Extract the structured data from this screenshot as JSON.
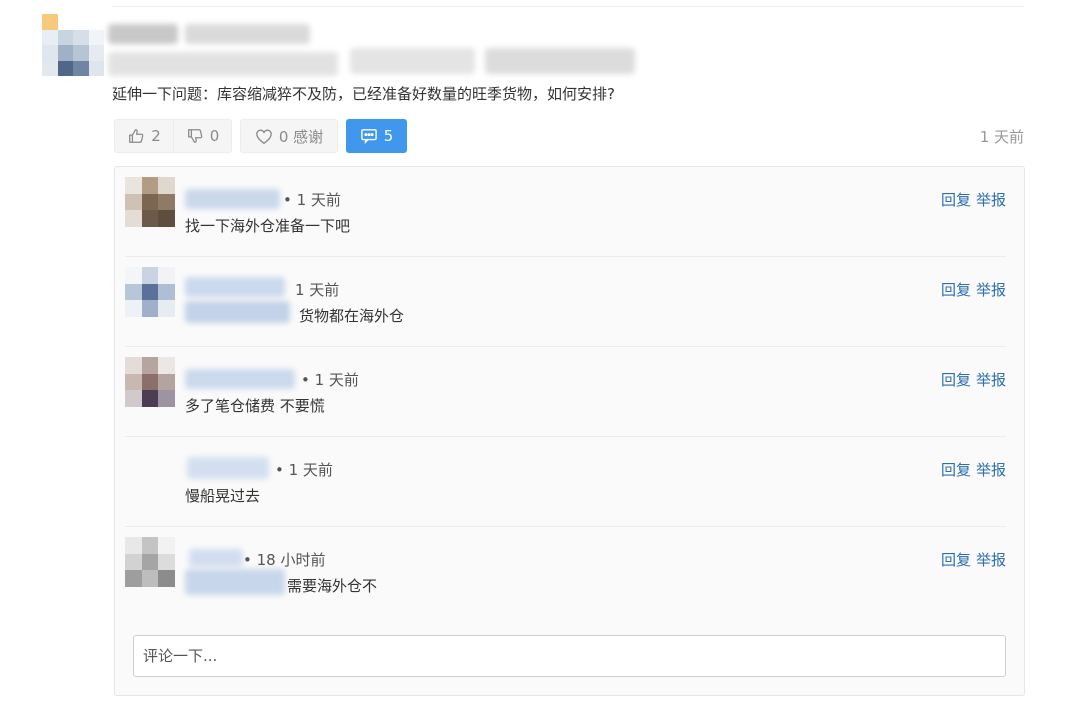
{
  "question": {
    "text": "延伸一下问题：库容缩减猝不及防，已经准备好数量的旺季货物，如何安排?",
    "time": "1 天前",
    "like_count": "2",
    "dislike_count": "0",
    "thanks_label": "0 感谢",
    "comment_count": "5"
  },
  "comments": [
    {
      "meta": "• 1 天前",
      "text": "找一下海外仓准备一下吧"
    },
    {
      "meta": "1 天前",
      "text": "货物都在海外仓"
    },
    {
      "meta": "• 1 天前",
      "text": "多了笔仓储费 不要慌"
    },
    {
      "meta": "• 1 天前",
      "text": "慢船晃过去"
    },
    {
      "meta": "• 18 小时前",
      "text": "需要海外仓不"
    }
  ],
  "comment_actions": {
    "reply": "回复",
    "report": "举报"
  },
  "comment_input": {
    "placeholder": "评论一下..."
  },
  "colors": {
    "accent": "#3f97ee",
    "link": "#2d6fb1",
    "panel": "#fafafa"
  }
}
